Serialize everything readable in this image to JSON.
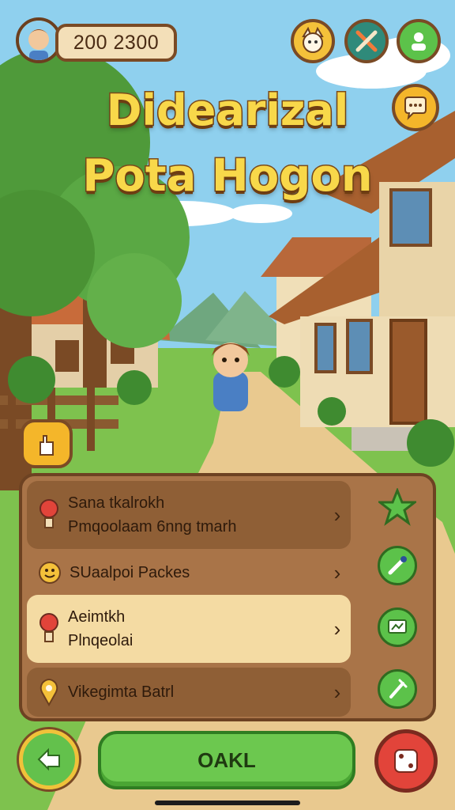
{
  "hud": {
    "coins": "200 2300",
    "avatar_icon": "player-avatar",
    "buttons": [
      {
        "icon": "pet-icon"
      },
      {
        "icon": "crossed-tools-icon"
      },
      {
        "icon": "profile-icon"
      }
    ],
    "chat_icon": "chat-bubble-icon"
  },
  "title": {
    "line1": "Didearizal",
    "line2": "Pota Hogon"
  },
  "side_button_icon": "hand-icon",
  "menu": {
    "items": [
      {
        "line1": "Sana tkalrokh",
        "line2": "Pmqoolaam 6nng tmarh",
        "icon": "lightbulb-icon"
      },
      {
        "line1": "SUaalpoi Packes",
        "line2": "",
        "icon": "smiley-icon"
      },
      {
        "line1": "Aeimtkh",
        "line2": "Plnqeolai",
        "icon": "lightbulb-icon"
      },
      {
        "line1": "Vikegimta Batrl",
        "line2": "",
        "icon": "map-pin-icon"
      }
    ],
    "side_icons": [
      "star-icon",
      "pen-icon",
      "screen-icon",
      "fork-icon"
    ]
  },
  "bottom": {
    "ok_label": "OAKL",
    "back_icon": "back-arrow-icon",
    "dice_icon": "dice-icon"
  },
  "colors": {
    "accent_green": "#6cc84f",
    "title_yellow": "#f8d84a",
    "panel_brown": "#a97448",
    "highlight": "#f4dba3",
    "danger_red": "#e2443a"
  }
}
